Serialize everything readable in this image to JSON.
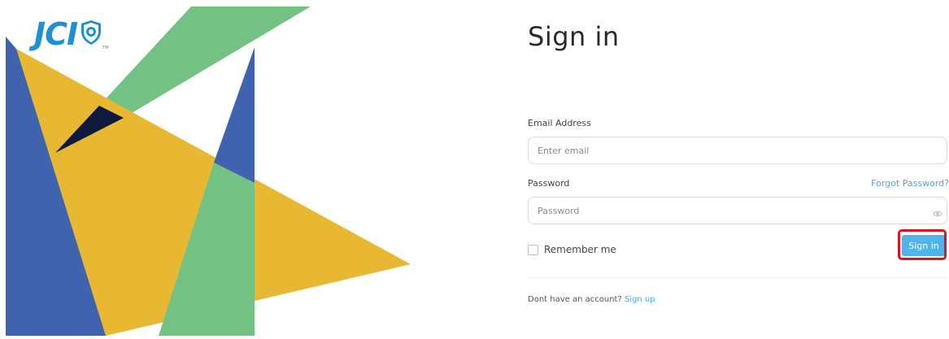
{
  "brand": {
    "logo_text": "JCI",
    "trademark": "TM",
    "primary_color": "#1e90d6"
  },
  "colors": {
    "yellow": "#e8b832",
    "blue": "#3f63ae",
    "green": "#73c283",
    "navy": "#0d1a3d",
    "accent": "#4fb3ec",
    "highlight": "#e0141e"
  },
  "signin": {
    "title": "Sign in",
    "email_label": "Email Address",
    "email_placeholder": "Enter email",
    "password_label": "Password",
    "password_placeholder": "Password",
    "forgot_password": "Forgot Password?",
    "remember_me": "Remember me",
    "remember_checked": false,
    "submit_label": "Sign in",
    "signup_prompt": "Dont have an account?",
    "signup_link": "Sign up"
  },
  "icons": {
    "logo_emblem": "shield-icon",
    "password_toggle": "eye-icon"
  }
}
